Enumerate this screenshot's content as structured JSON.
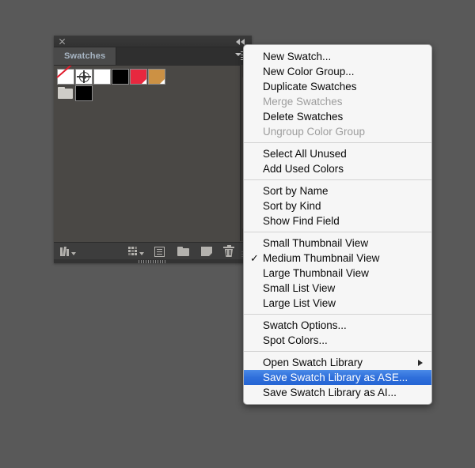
{
  "panel": {
    "tab_label": "Swatches",
    "close_icon": "close-icon",
    "collapse_icon": "collapse-to-icons-icon",
    "menu_icon": "panel-menu-icon",
    "swatches": [
      {
        "name": "None",
        "kind": "none",
        "color": "#ffffff"
      },
      {
        "name": "Registration",
        "kind": "registration",
        "color": "#ffffff"
      },
      {
        "name": "White",
        "kind": "process",
        "color": "#ffffff"
      },
      {
        "name": "Black",
        "kind": "process",
        "color": "#000000"
      },
      {
        "name": "CMYK Red",
        "kind": "spot",
        "color": "#e8283f"
      },
      {
        "name": "Spot Orange",
        "kind": "spot",
        "color": "#cc9144"
      },
      {
        "name": "Color Group",
        "kind": "folder",
        "color": "#cfcdc8"
      },
      {
        "name": "Black Group",
        "kind": "process",
        "color": "#000000"
      }
    ],
    "footer_icons": [
      {
        "name": "swatch-libraries-menu-icon",
        "label": "Swatch Libraries menu"
      },
      {
        "name": "show-swatch-kinds-menu-icon",
        "label": "Show Swatch Kinds menu"
      },
      {
        "name": "swatch-options-icon",
        "label": "Swatch Options"
      },
      {
        "name": "new-color-group-icon",
        "label": "New Color Group"
      },
      {
        "name": "new-swatch-icon",
        "label": "New Swatch"
      },
      {
        "name": "delete-swatch-icon",
        "label": "Delete Swatch"
      }
    ]
  },
  "menu": {
    "groups": [
      {
        "items": [
          {
            "label": "New Swatch...",
            "state": "normal"
          },
          {
            "label": "New Color Group...",
            "state": "normal"
          },
          {
            "label": "Duplicate Swatches",
            "state": "normal"
          },
          {
            "label": "Merge Swatches",
            "state": "disabled"
          },
          {
            "label": "Delete Swatches",
            "state": "normal"
          },
          {
            "label": "Ungroup Color Group",
            "state": "disabled"
          }
        ]
      },
      {
        "items": [
          {
            "label": "Select All Unused",
            "state": "normal"
          },
          {
            "label": "Add Used Colors",
            "state": "normal"
          }
        ]
      },
      {
        "items": [
          {
            "label": "Sort by Name",
            "state": "normal"
          },
          {
            "label": "Sort by Kind",
            "state": "normal"
          },
          {
            "label": "Show Find Field",
            "state": "normal"
          }
        ]
      },
      {
        "items": [
          {
            "label": "Small Thumbnail View",
            "state": "normal"
          },
          {
            "label": "Medium Thumbnail View",
            "state": "normal",
            "checked": true
          },
          {
            "label": "Large Thumbnail View",
            "state": "normal"
          },
          {
            "label": "Small List View",
            "state": "normal"
          },
          {
            "label": "Large List View",
            "state": "normal"
          }
        ]
      },
      {
        "items": [
          {
            "label": "Swatch Options...",
            "state": "normal"
          },
          {
            "label": "Spot Colors...",
            "state": "normal"
          }
        ]
      },
      {
        "items": [
          {
            "label": "Open Swatch Library",
            "state": "normal",
            "submenu": true
          },
          {
            "label": "Save Swatch Library as ASE...",
            "state": "selected"
          },
          {
            "label": "Save Swatch Library as AI...",
            "state": "normal"
          }
        ]
      }
    ],
    "check_glyph": "✓"
  },
  "colors": {
    "page_background": "#595959",
    "panel_background": "#3d3d3d",
    "swatch_area": "#4a4845",
    "menu_background": "#f6f6f6",
    "highlight": "#2f6fdb",
    "tab_text": "#a8b6c4"
  }
}
